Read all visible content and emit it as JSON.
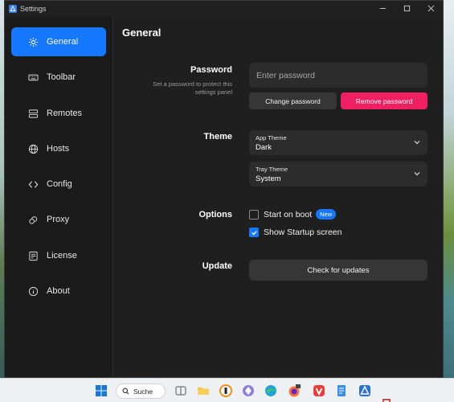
{
  "window": {
    "title": "Settings"
  },
  "sidebar": {
    "items": [
      {
        "label": "General",
        "icon": "gear-icon",
        "active": true
      },
      {
        "label": "Toolbar",
        "icon": "keyboard-icon"
      },
      {
        "label": "Remotes",
        "icon": "server-icon"
      },
      {
        "label": "Hosts",
        "icon": "globe-icon"
      },
      {
        "label": "Config",
        "icon": "code-icon"
      },
      {
        "label": "Proxy",
        "icon": "proxy-icon"
      },
      {
        "label": "License",
        "icon": "license-icon"
      },
      {
        "label": "About",
        "icon": "info-icon"
      }
    ]
  },
  "main": {
    "title": "General",
    "password": {
      "label": "Password",
      "description": "Set a password to protect this settings panel",
      "placeholder": "Enter password",
      "change_label": "Change password",
      "remove_label": "Remove password"
    },
    "theme": {
      "label": "Theme",
      "app_theme_label": "App Theme",
      "app_theme_value": "Dark",
      "tray_theme_label": "Tray Theme",
      "tray_theme_value": "System"
    },
    "options": {
      "label": "Options",
      "start_on_boot": {
        "label": "Start on boot",
        "checked": false,
        "badge": "New"
      },
      "show_startup": {
        "label": "Show Startup screen",
        "checked": true
      }
    },
    "update": {
      "label": "Update",
      "button_label": "Check for updates"
    }
  },
  "taskbar": {
    "search_label": "Suche"
  },
  "colors": {
    "accent": "#1677ff",
    "danger": "#ef1f62",
    "background": "#1f1f1f"
  }
}
